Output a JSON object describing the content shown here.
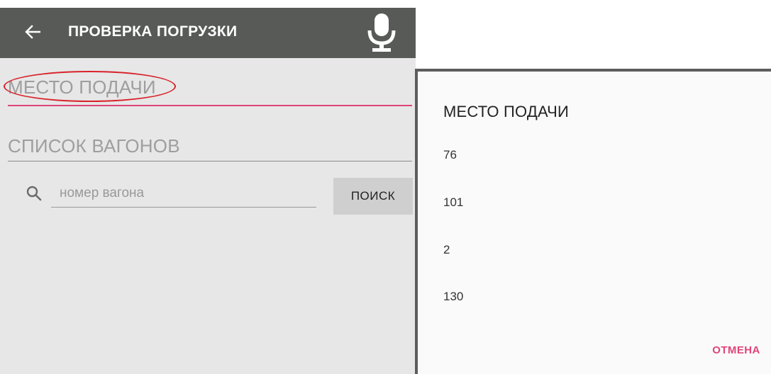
{
  "toolbar": {
    "title": "ПРОВЕРКА ПОГРУЗКИ",
    "back_icon": "arrow-left-icon",
    "mic_icon": "microphone-icon",
    "background": "#585a58"
  },
  "form": {
    "place_field_label": "МЕСТО ПОДАЧИ",
    "wagons_field_label": "СПИСОК ВАГОНОВ",
    "accent_color": "#e0457a",
    "highlight_color": "#d8232a"
  },
  "search": {
    "icon": "search-icon",
    "placeholder": "номер вагона",
    "button_label": "ПОИСК"
  },
  "dialog": {
    "title": "МЕСТО ПОДАЧИ",
    "options": [
      "76",
      "101",
      "2",
      "130"
    ],
    "cancel_label": "ОТМЕНА"
  }
}
